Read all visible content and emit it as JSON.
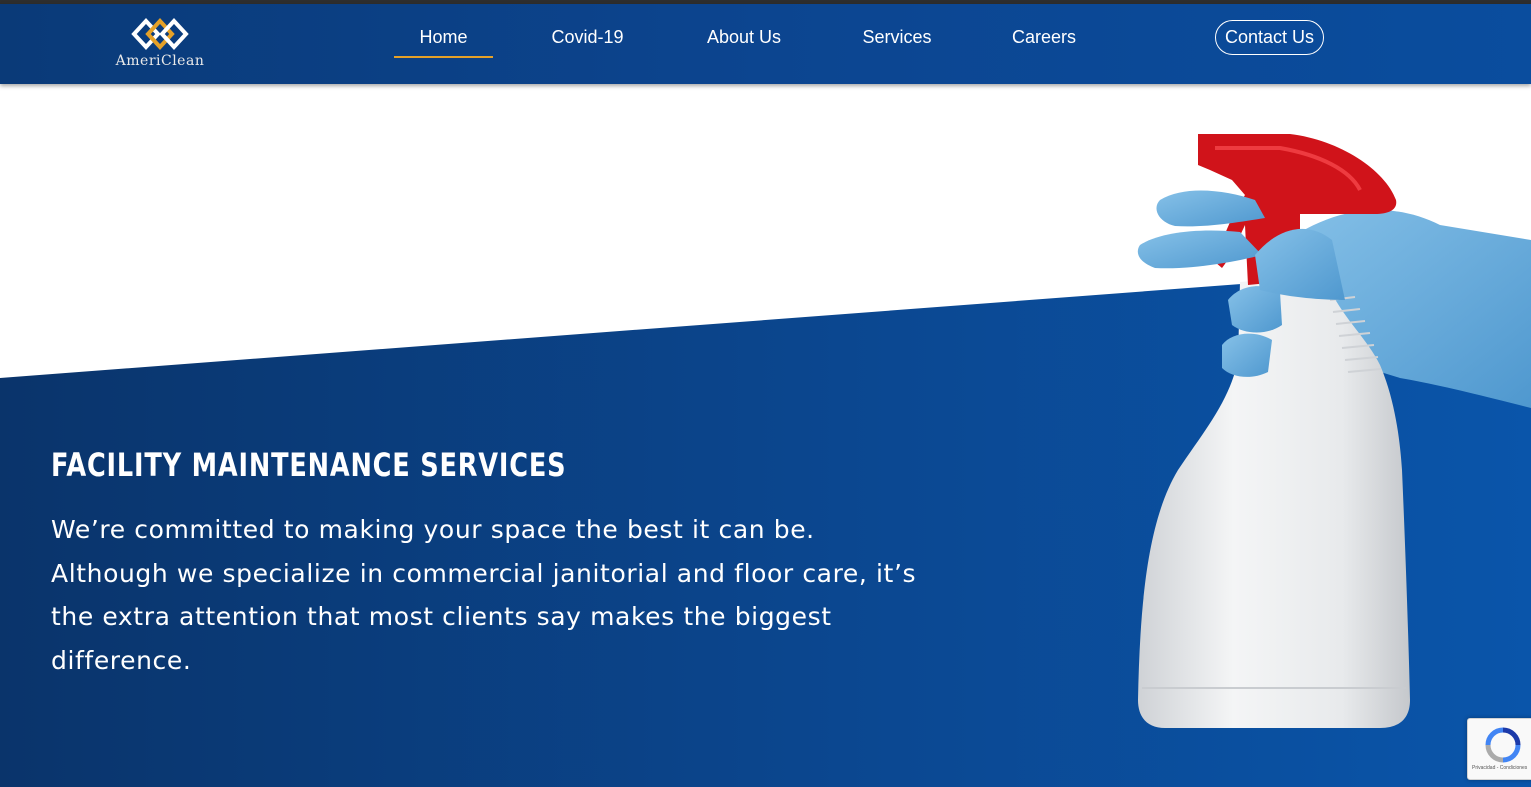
{
  "brand": {
    "name": "AmeriClean"
  },
  "nav": {
    "items": [
      {
        "label": "Home",
        "active": true
      },
      {
        "label": "Covid-19",
        "active": false
      },
      {
        "label": "About Us",
        "active": false
      },
      {
        "label": "Services",
        "active": false
      },
      {
        "label": "Careers",
        "active": false
      }
    ],
    "contact_label": "Contact Us"
  },
  "hero": {
    "title": "FACILITY MAINTENANCE SERVICES",
    "text": "We’re committed to making your space the best it can be. Although we specialize in commercial janitorial and floor care, it’s the extra attention that most clients say makes the biggest difference."
  },
  "recaptcha": {
    "footer_text": "Privacidad - Condiciones"
  },
  "colors": {
    "header": "#0c4590",
    "hero_blue": "#0a4f9f",
    "accent": "#e5a128",
    "trigger_red": "#d0131a",
    "glove_blue": "#6aaedd"
  }
}
